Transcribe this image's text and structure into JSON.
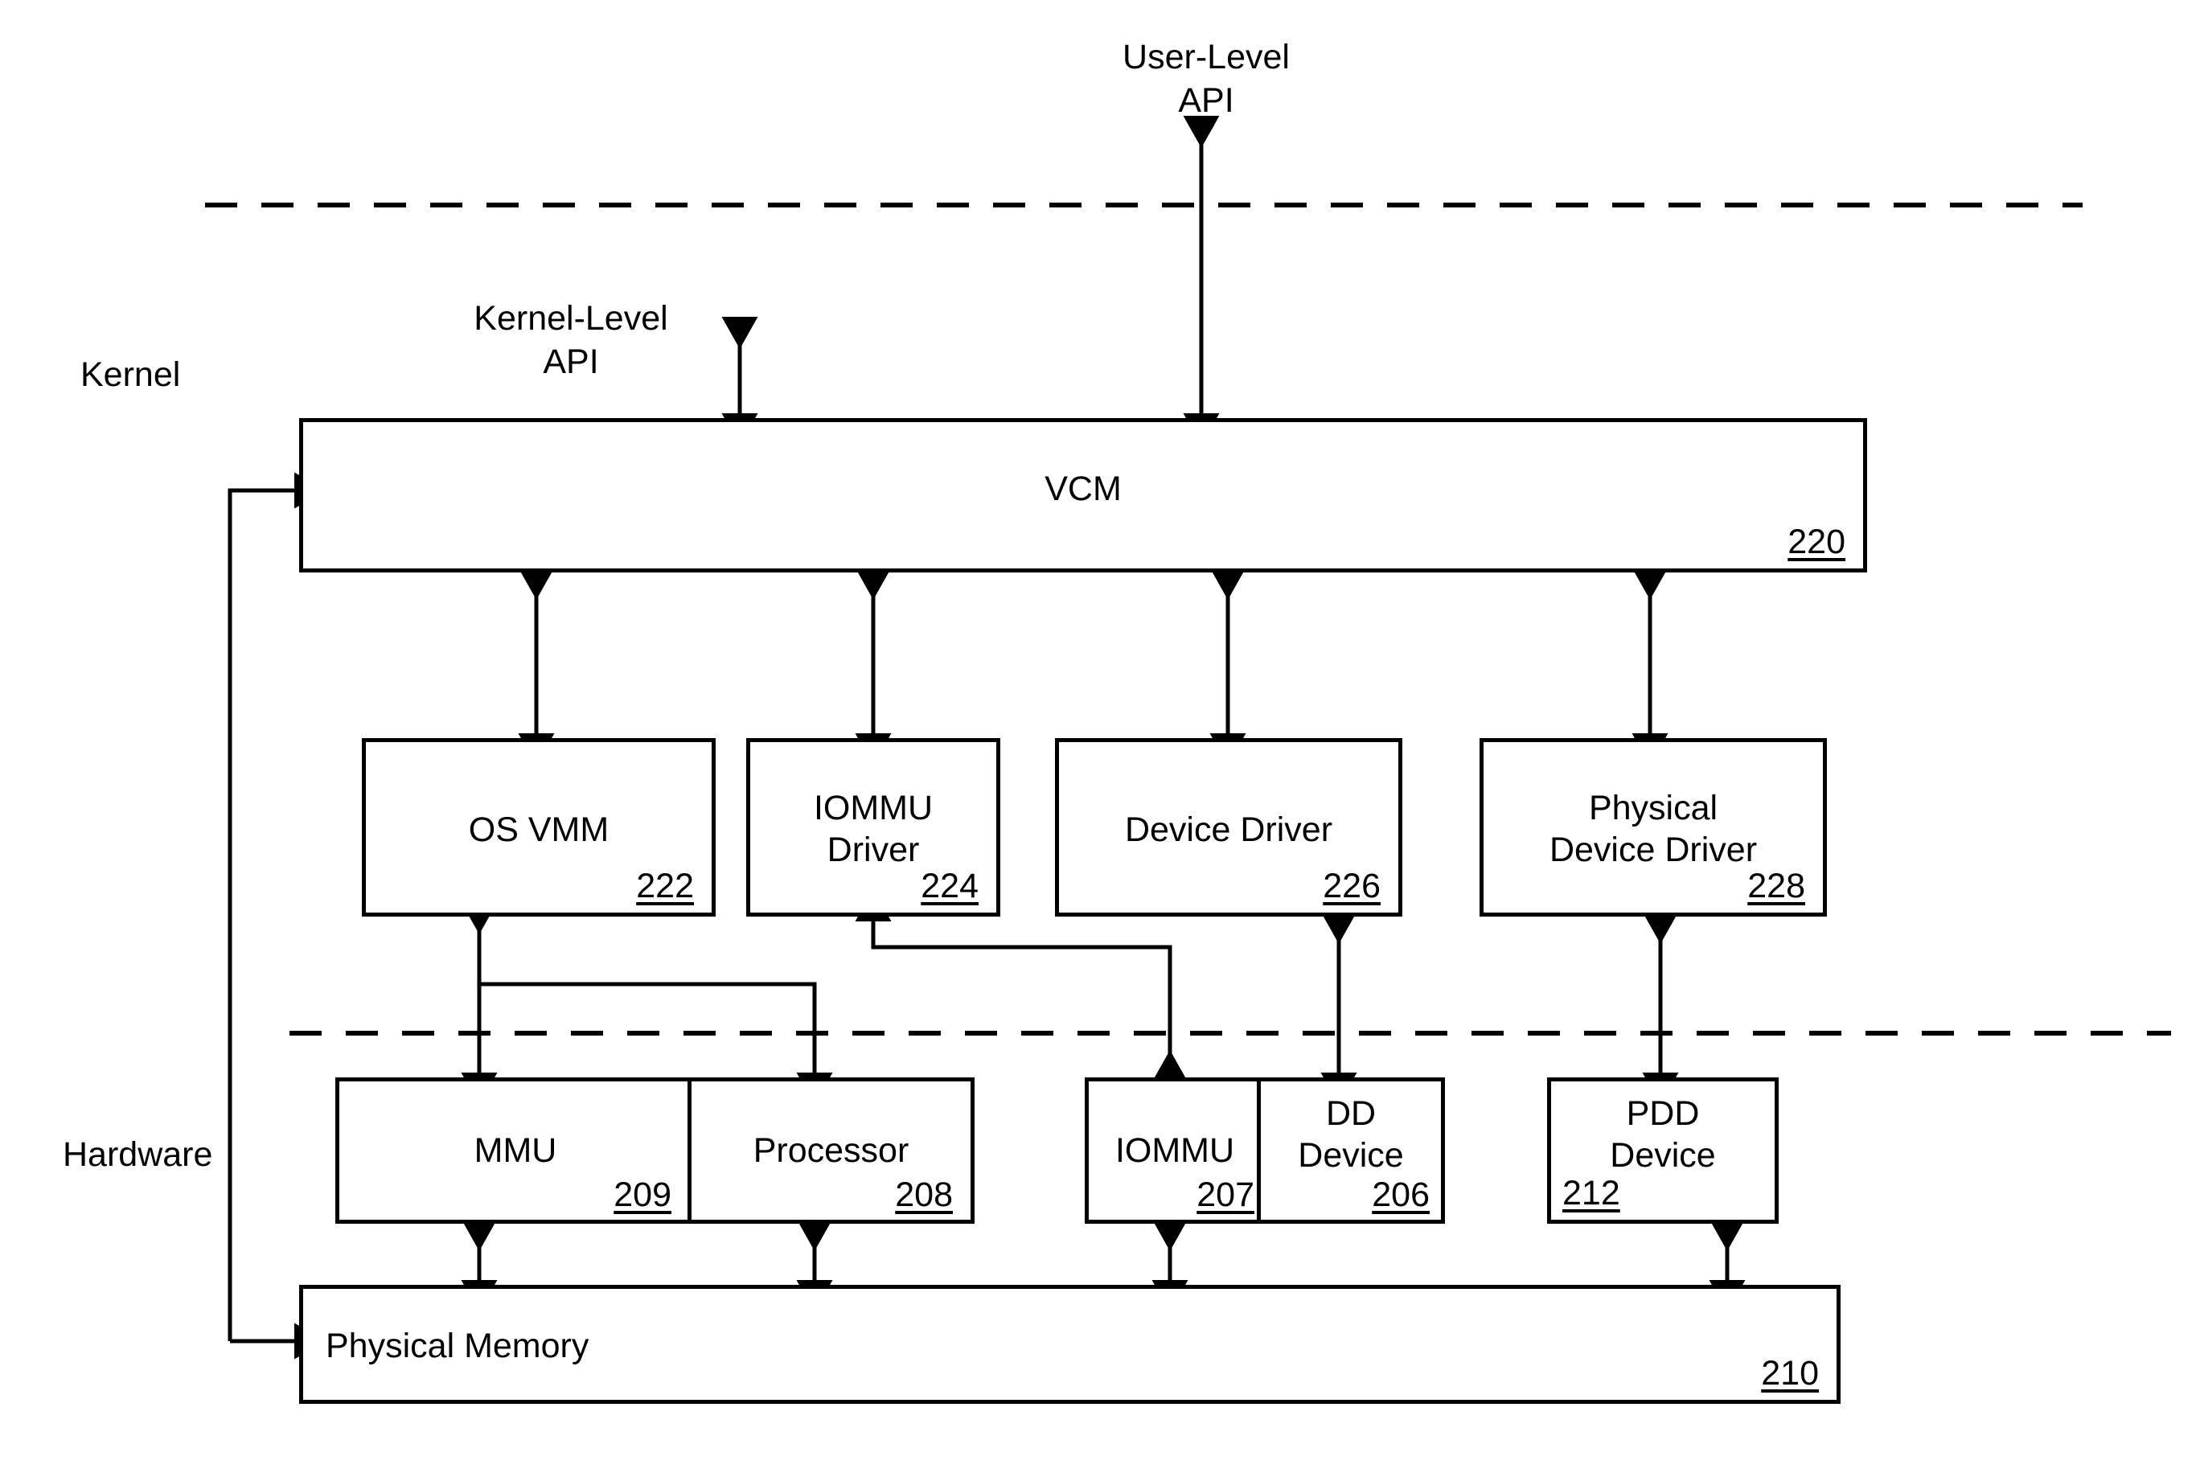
{
  "diagram": {
    "title": "VCM kernel / hardware architecture block diagram",
    "labels": {
      "user_level_api": "User-Level\nAPI",
      "kernel_level_api": "Kernel-Level\nAPI",
      "kernel": "Kernel",
      "hardware": "Hardware"
    },
    "blocks": {
      "vcm": {
        "name": "VCM",
        "ref": "220"
      },
      "os_vmm": {
        "name": "OS VMM",
        "ref": "222"
      },
      "iommu_driver": {
        "name": "IOMMU\nDriver",
        "ref": "224"
      },
      "device_driver": {
        "name": "Device Driver",
        "ref": "226"
      },
      "phys_dev_driver": {
        "name": "Physical\nDevice Driver",
        "ref": "228"
      },
      "mmu": {
        "name": "MMU",
        "ref": "209"
      },
      "processor": {
        "name": "Processor",
        "ref": "208"
      },
      "iommu": {
        "name": "IOMMU",
        "ref": "207"
      },
      "dd_device": {
        "name": "DD\nDevice",
        "ref": "206"
      },
      "pdd_device": {
        "name": "PDD\nDevice",
        "ref": "212"
      },
      "physical_memory": {
        "name": "Physical Memory",
        "ref": "210"
      }
    },
    "colors": {
      "stroke": "#000000",
      "background": "#ffffff"
    }
  }
}
